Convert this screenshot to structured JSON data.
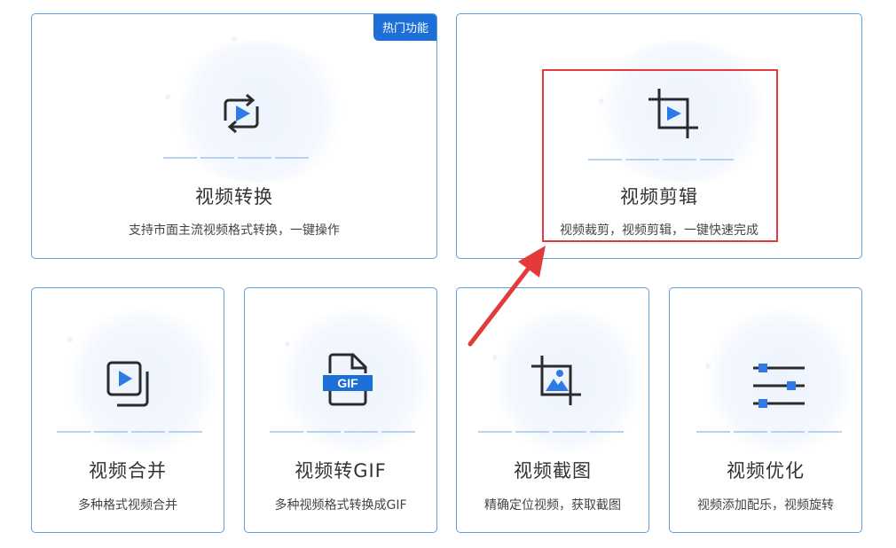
{
  "cards": {
    "convert": {
      "title": "视频转换",
      "desc": "支持市面主流视频格式转换，一键操作",
      "badge": "热门功能",
      "icon": "video-convert-icon"
    },
    "edit": {
      "title": "视频剪辑",
      "desc": "视频裁剪，视频剪辑，一键快速完成",
      "icon": "video-crop-icon"
    },
    "merge": {
      "title": "视频合并",
      "desc": "多种格式视频合并",
      "icon": "video-merge-icon"
    },
    "gif": {
      "title": "视频转GIF",
      "desc": "多种视频格式转换成GIF",
      "icon_label": "GIF",
      "icon": "gif-file-icon"
    },
    "screenshot": {
      "title": "视频截图",
      "desc": "精确定位视频，获取截图",
      "icon": "image-crop-icon"
    },
    "optimize": {
      "title": "视频优化",
      "desc": "视频添加配乐，视频旋转",
      "icon": "sliders-icon"
    }
  },
  "colors": {
    "accent": "#1b6fd6",
    "card_border": "#5b9fe0",
    "icon_blue": "#2f7ae5",
    "icon_dark": "#2b2b2b",
    "annotation_red": "#e33b3b"
  }
}
